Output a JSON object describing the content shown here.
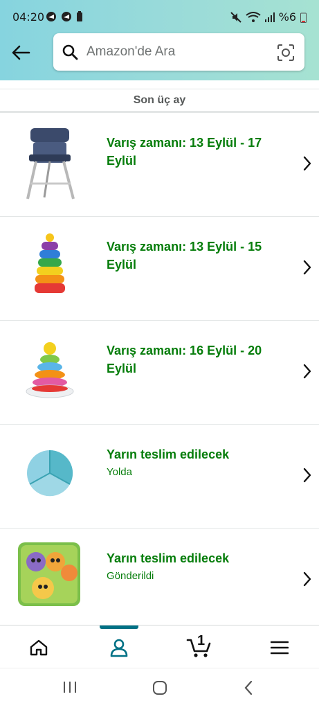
{
  "status_bar": {
    "time": "04:20",
    "battery": "%6"
  },
  "search": {
    "placeholder": "Amazon'de Ara"
  },
  "section": {
    "heading": "Son üç ay"
  },
  "orders": [
    {
      "title": "Varış zamanı: 13 Eylül - 17 Eylül",
      "subtitle": "",
      "thumb": "high-chair"
    },
    {
      "title": "Varış zamanı: 13 Eylül - 15 Eylül",
      "subtitle": "",
      "thumb": "stacking-rings"
    },
    {
      "title": "Varış zamanı: 16 Eylül - 20 Eylül",
      "subtitle": "",
      "thumb": "stacking-rings-2"
    },
    {
      "title": "Yarın teslim edilecek",
      "subtitle": "Yolda",
      "thumb": "divided-plate"
    },
    {
      "title": "Yarın teslim edilecek",
      "subtitle": "Gönderildi",
      "thumb": "soft-book"
    }
  ],
  "tabbar": {
    "cart_count": "1",
    "active_tab": "account"
  },
  "colors": {
    "header_gradient_start": "#86d4df",
    "header_gradient_end": "#a6e2d2",
    "status_green": "#067d0b",
    "accent": "#007185"
  }
}
